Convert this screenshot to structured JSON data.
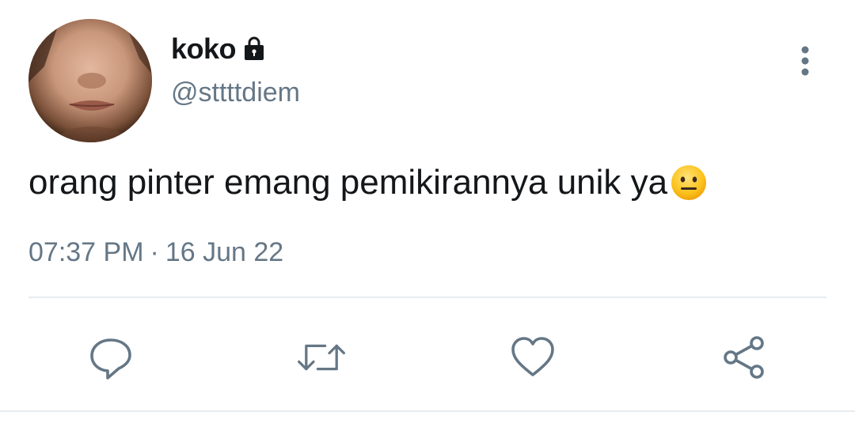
{
  "user": {
    "display_name": "koko",
    "handle": "@sttttdiem",
    "protected_icon": "lock-icon",
    "avatar_icon": "avatar-photo"
  },
  "tweet": {
    "text": "orang pinter emang pemikirannya unik ya",
    "emoji": "neutral-face-emoji",
    "time": "07:37 PM",
    "separator": "·",
    "date": "16 Jun 22"
  },
  "actions": {
    "reply_icon": "reply-icon",
    "retweet_icon": "retweet-icon",
    "like_icon": "heart-icon",
    "share_icon": "share-icon",
    "more_icon": "more-vertical-icon"
  },
  "colors": {
    "text_primary": "#14171a",
    "text_secondary": "#657786",
    "divider": "#e6ecf0",
    "icon": "#657786"
  }
}
